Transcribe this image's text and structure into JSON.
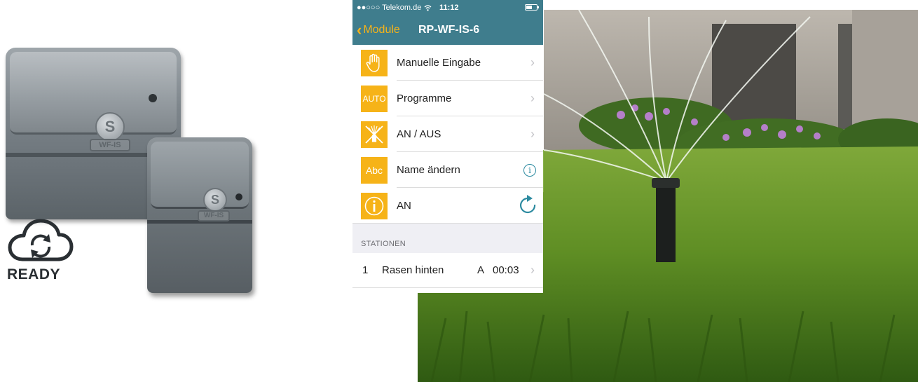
{
  "product": {
    "large_unit_brand": "WF-IS",
    "small_unit_brand": "WF-IS",
    "badge_letter": "S",
    "ready_label": "READY"
  },
  "phone": {
    "statusbar": {
      "carrier": "●●○○○ Telekom.de",
      "time": "11:12"
    },
    "navbar": {
      "back_label": "Module",
      "title": "RP-WF-IS-6"
    },
    "menu": [
      {
        "label": "Manuelle Eingabe",
        "icon": "hand-icon"
      },
      {
        "label": "Programme",
        "icon": "auto-icon",
        "icon_text": "AUTO"
      },
      {
        "label": "AN / AUS",
        "icon": "sprinkler-off-icon"
      },
      {
        "label": "Name ändern",
        "icon": "abc-icon",
        "icon_text": "Abc"
      },
      {
        "label": "AN",
        "icon": "info-icon"
      }
    ],
    "section_header": "STATIONEN",
    "stations": [
      {
        "number": "1",
        "name": "Rasen hinten",
        "program": "A",
        "duration": "00:03"
      }
    ],
    "colors": {
      "header": "#3f7d8d",
      "accent": "#f6b318",
      "link_icon": "#2c8aa0"
    }
  }
}
